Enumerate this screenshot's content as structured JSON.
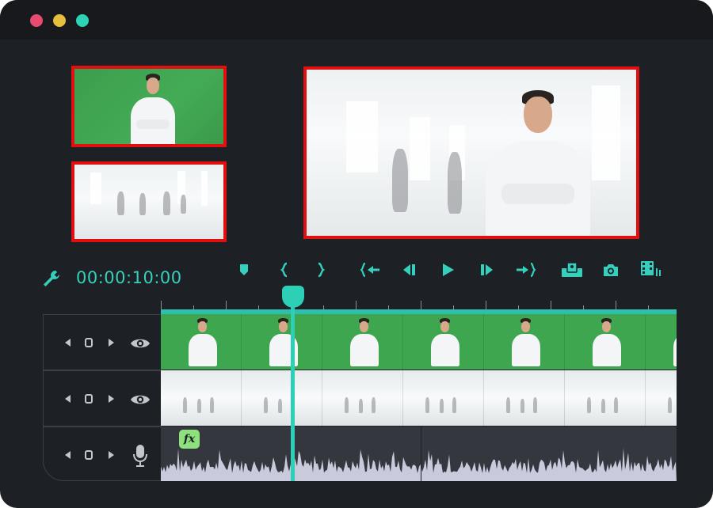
{
  "window": {
    "traffic_lights": [
      "close-dot",
      "minimize-dot",
      "maximize-dot"
    ]
  },
  "colors": {
    "accent": "#2ecfb7",
    "highlight_border": "#e10f0f",
    "window_bg": "#1d2024",
    "green_screen": "#3fa650",
    "fx_badge": "#8ee27e"
  },
  "previews": {
    "source_green_screen": "green-screen-source-preview",
    "source_background": "office-background-preview",
    "composite": "composite-result-preview"
  },
  "toolbar": {
    "timecode": "00:00:10:00",
    "tools": [
      "marker-icon",
      "mark-in-icon",
      "mark-out-icon",
      "go-to-in-icon",
      "previous-frame-icon",
      "play-icon",
      "next-frame-icon",
      "go-to-out-icon",
      "picture-in-picture-icon",
      "snapshot-icon",
      "export-film-icon"
    ]
  },
  "timeline": {
    "tracks": [
      {
        "type": "video",
        "content": "green-screen-clip",
        "visibility_icon": "eye-icon"
      },
      {
        "type": "video",
        "content": "office-background-clip",
        "visibility_icon": "eye-icon"
      },
      {
        "type": "audio",
        "content": "audio-waveform",
        "visibility_icon": "microphone-icon"
      }
    ],
    "fx_label": "fx"
  }
}
